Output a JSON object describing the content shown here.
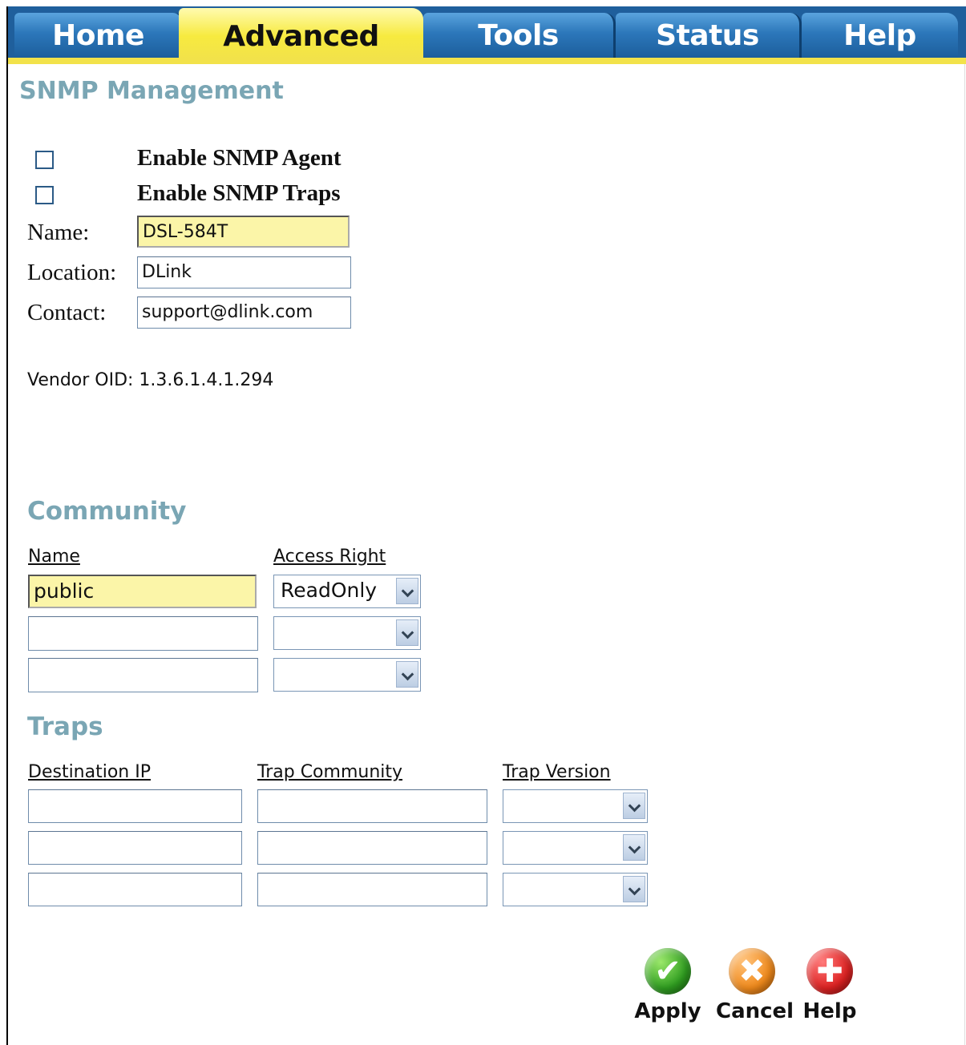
{
  "tabs": [
    {
      "label": "Home",
      "active": false
    },
    {
      "label": "Advanced",
      "active": true
    },
    {
      "label": "Tools",
      "active": false
    },
    {
      "label": "Status",
      "active": false
    },
    {
      "label": "Help",
      "active": false
    }
  ],
  "page_title": "SNMP Management",
  "options": {
    "enable_agent_label": "Enable SNMP Agent",
    "enable_agent_checked": false,
    "enable_traps_label": "Enable SNMP Traps",
    "enable_traps_checked": false
  },
  "fields": {
    "name_label": "Name:",
    "name_value": "DSL-584T",
    "location_label": "Location:",
    "location_value": "DLink",
    "contact_label": "Contact:",
    "contact_value": "support@dlink.com"
  },
  "vendor_oid_text": "Vendor OID: 1.3.6.1.4.1.294",
  "community": {
    "title": "Community",
    "col_name": "Name",
    "col_access": "Access Right",
    "rows": [
      {
        "name": "public",
        "access": "ReadOnly"
      },
      {
        "name": "",
        "access": ""
      },
      {
        "name": "",
        "access": ""
      }
    ]
  },
  "traps": {
    "title": "Traps",
    "col_dest": "Destination IP",
    "col_community": "Trap Community",
    "col_version": "Trap Version",
    "rows": [
      {
        "dest": "",
        "community": "",
        "version": ""
      },
      {
        "dest": "",
        "community": "",
        "version": ""
      },
      {
        "dest": "",
        "community": "",
        "version": ""
      }
    ]
  },
  "buttons": {
    "apply": "Apply",
    "cancel": "Cancel",
    "help": "Help"
  },
  "icons": {
    "apply": "check-icon",
    "cancel": "x-icon",
    "help": "plus-icon"
  },
  "colors": {
    "tab_bar": "#1f5f9c",
    "active_tab": "#f2e24a",
    "section_title": "#7aa6b4",
    "highlight_input": "#fbf5a8"
  }
}
